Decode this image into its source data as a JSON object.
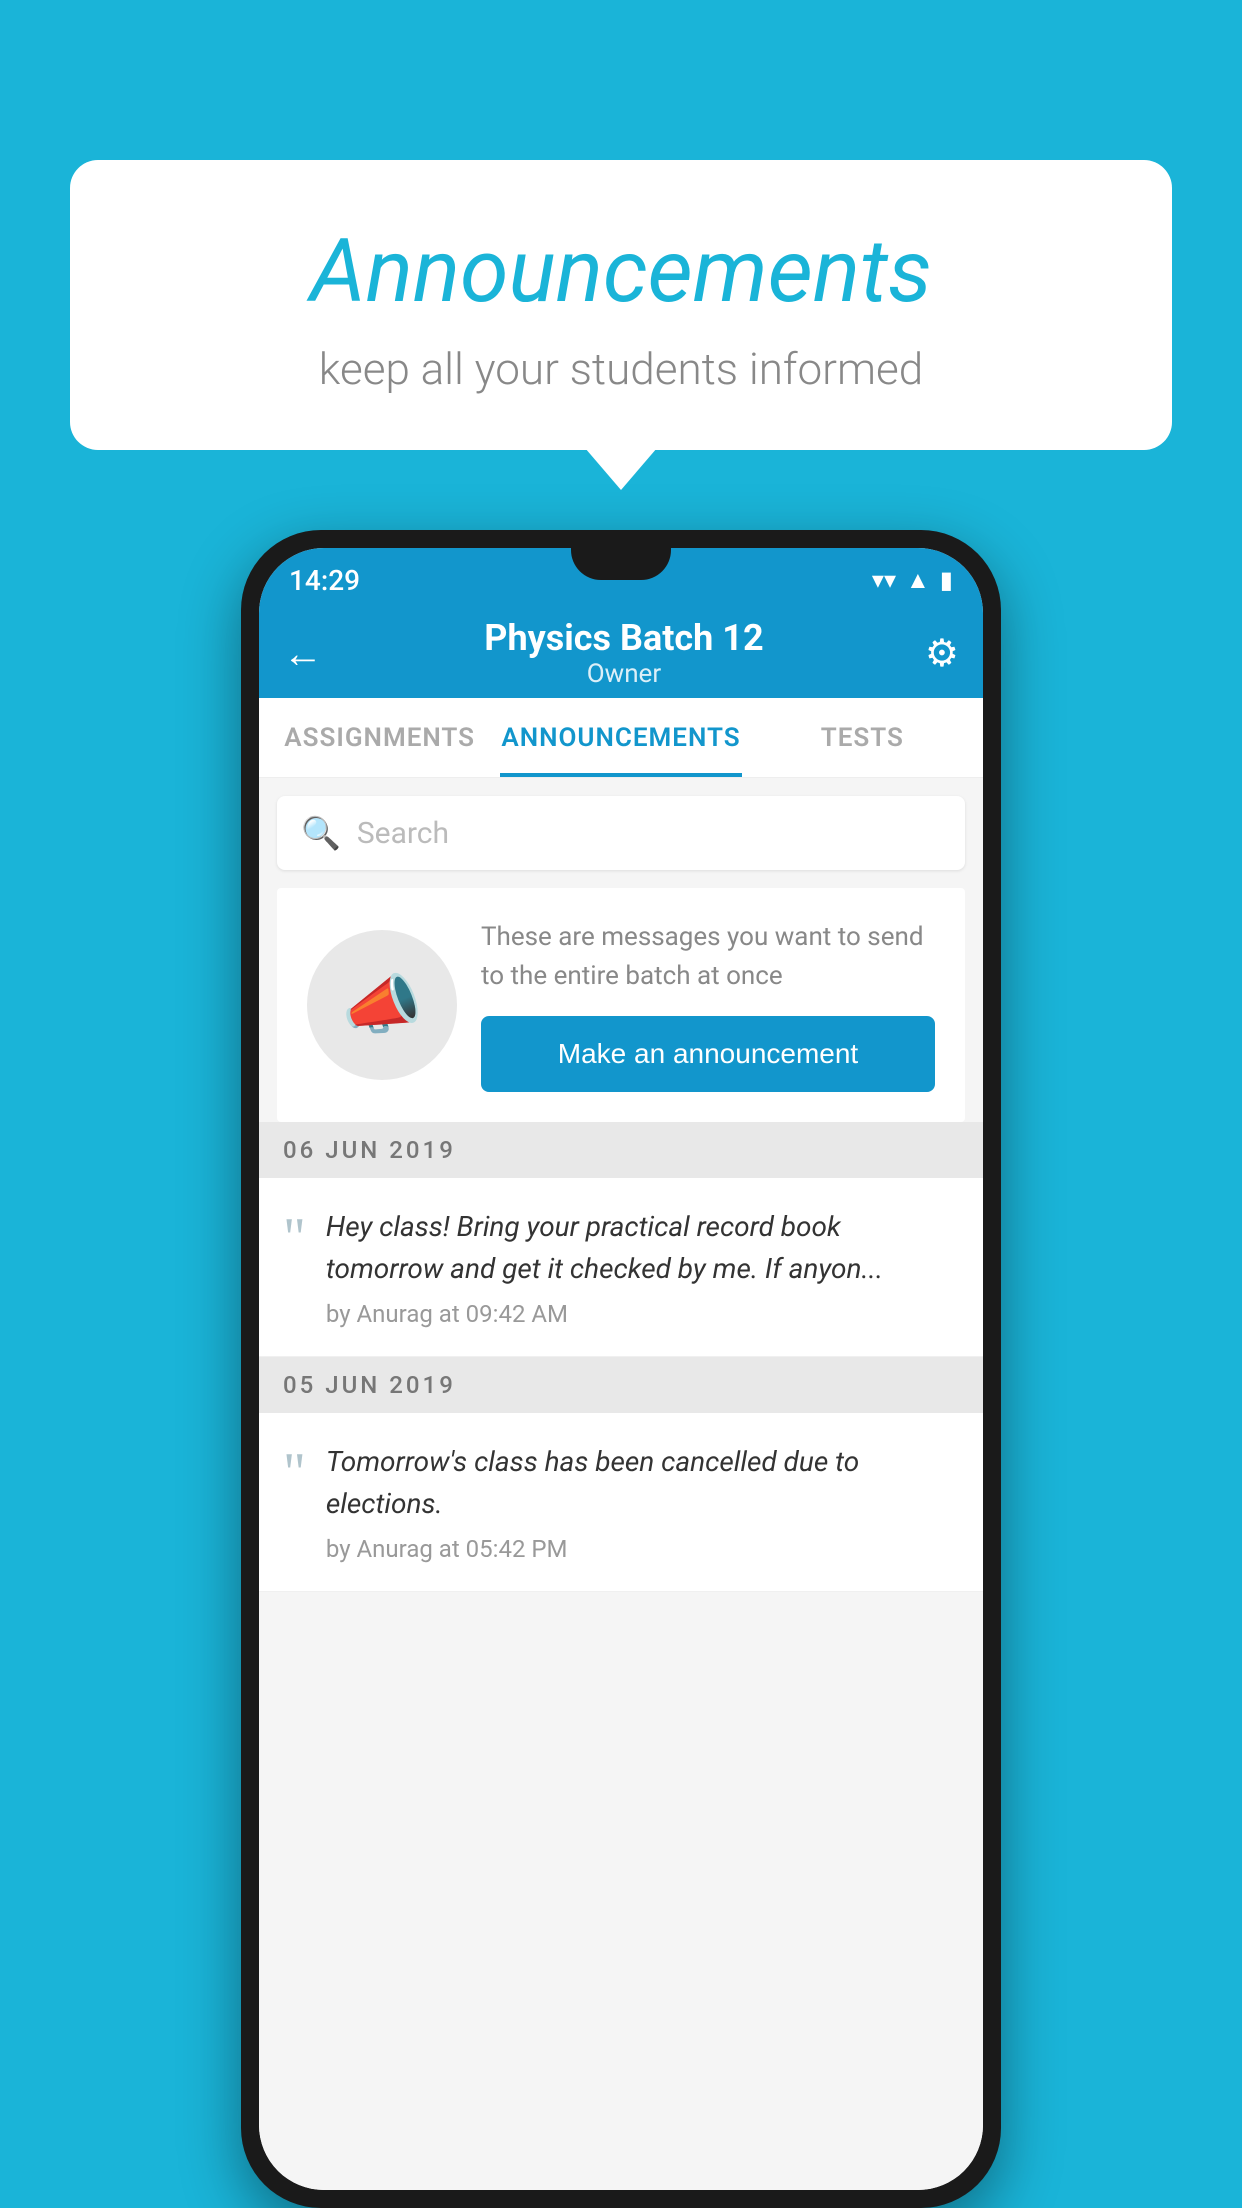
{
  "background_color": "#1ab4d8",
  "speech_bubble": {
    "title": "Announcements",
    "subtitle": "keep all your students informed"
  },
  "phone": {
    "status_bar": {
      "time": "14:29",
      "icons": [
        "wifi",
        "signal",
        "battery"
      ]
    },
    "app_bar": {
      "title": "Physics Batch 12",
      "subtitle": "Owner",
      "back_label": "←",
      "settings_label": "⚙"
    },
    "tabs": [
      {
        "label": "ASSIGNMENTS",
        "active": false
      },
      {
        "label": "ANNOUNCEMENTS",
        "active": true
      },
      {
        "label": "TESTS",
        "active": false
      }
    ],
    "search": {
      "placeholder": "Search"
    },
    "empty_state": {
      "description": "These are messages you want to send to the entire batch at once",
      "button_label": "Make an announcement"
    },
    "announcements": [
      {
        "date": "06  JUN  2019",
        "text": "Hey class! Bring your practical record book tomorrow and get it checked by me. If anyon...",
        "meta": "by Anurag at 09:42 AM"
      },
      {
        "date": "05  JUN  2019",
        "text": "Tomorrow's class has been cancelled due to elections.",
        "meta": "by Anurag at 05:42 PM"
      }
    ]
  }
}
